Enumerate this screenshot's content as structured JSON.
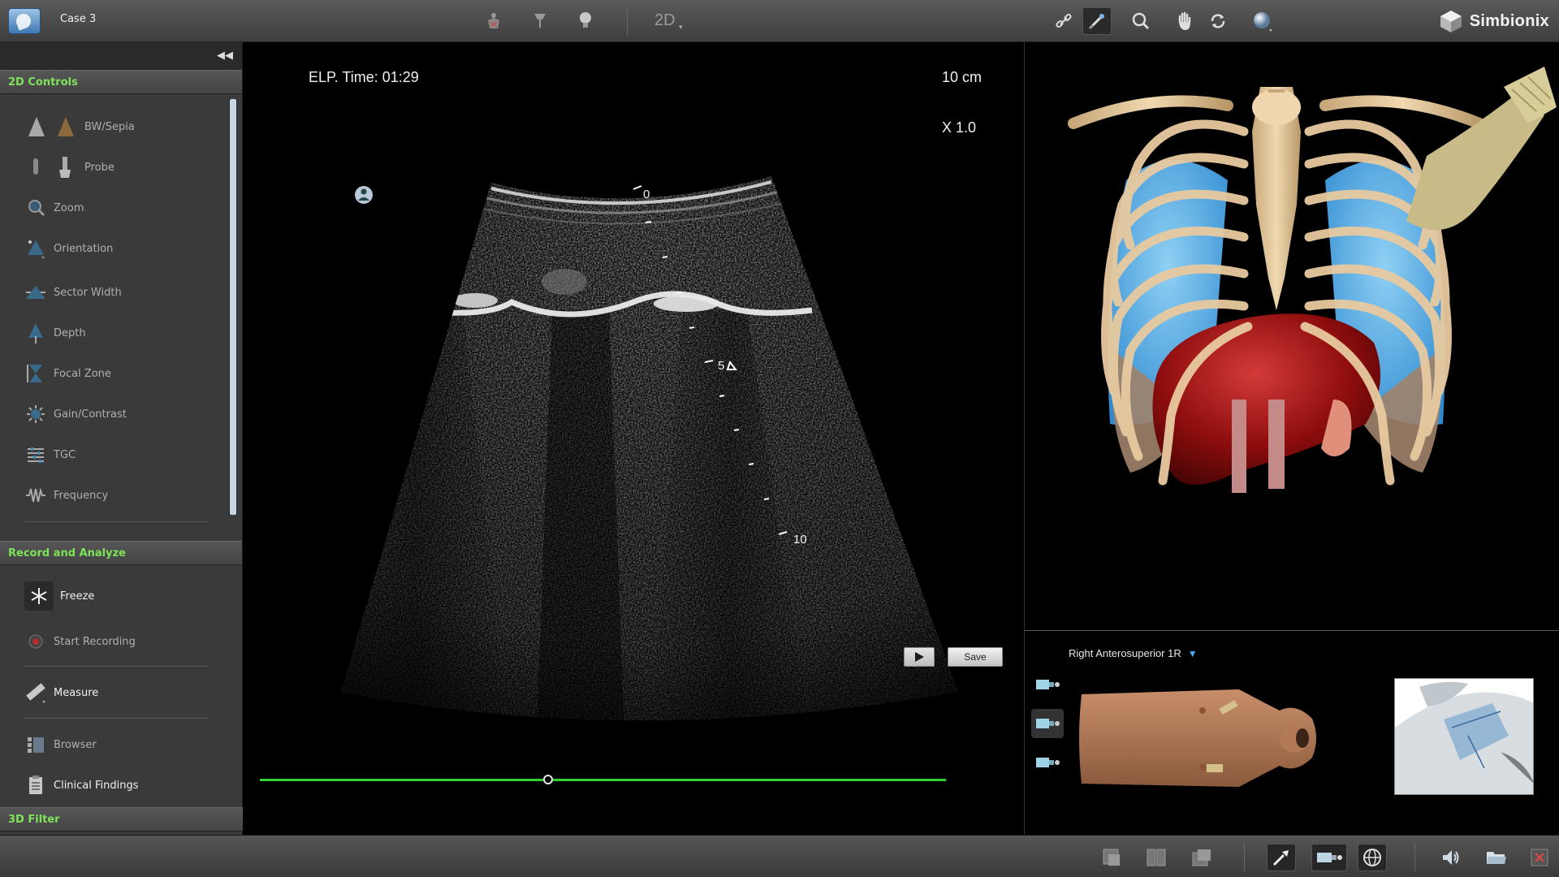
{
  "window": {
    "case_title": "Case 3",
    "brand": "Simbionix"
  },
  "toolbar": {
    "mode_label": "2D",
    "left_icons": [
      "patient-anatomy-icon",
      "pin-icon",
      "lightbulb-icon"
    ],
    "right_icons": [
      "link-icon",
      "probe-link-icon",
      "magnify-icon",
      "hand-pan-icon",
      "rotate-icon",
      "sphere-icon"
    ]
  },
  "sidebar": {
    "collapse_icon": "double-chevron-left-icon",
    "controls_header": "2D Controls",
    "controls": [
      {
        "label": "BW/Sepia",
        "icon": "bw-sepia-icon"
      },
      {
        "label": "Probe",
        "icon": "probe-icon"
      },
      {
        "label": "Zoom",
        "icon": "zoom-icon"
      },
      {
        "label": "Orientation",
        "icon": "orientation-icon"
      },
      {
        "label": "Sector Width",
        "icon": "sector-width-icon"
      },
      {
        "label": "Depth",
        "icon": "depth-icon"
      },
      {
        "label": "Focal Zone",
        "icon": "focal-zone-icon"
      },
      {
        "label": "Gain/Contrast",
        "icon": "gain-contrast-icon"
      },
      {
        "label": "TGC",
        "icon": "tgc-icon"
      },
      {
        "label": "Frequency",
        "icon": "frequency-icon"
      }
    ],
    "record_header": "Record and Analyze",
    "record_items": [
      {
        "label": "Freeze",
        "icon": "snowflake-icon"
      },
      {
        "label": "Start Recording",
        "icon": "record-icon"
      },
      {
        "label": "Measure",
        "icon": "ruler-icon"
      },
      {
        "label": "Browser",
        "icon": "browser-icon"
      },
      {
        "label": "Clinical Findings",
        "icon": "clipboard-icon"
      }
    ],
    "filter_header": "3D Filter"
  },
  "ultrasound": {
    "elapsed_time": "ELP. Time: 01:29",
    "depth": "10 cm",
    "zoom": "X 1.0",
    "depth_scale": [
      "0",
      "5",
      "10"
    ],
    "save_label": "Save",
    "scrub_position": 0.42
  },
  "probe_view": {
    "position_label": "Right Anterosuperior 1R",
    "dropdown_icon": "triangle-down-icon"
  },
  "bottom_toolbar": {
    "icons": [
      "single-view-icon",
      "split-view-icon",
      "overlap-view-icon",
      "probe-tool-icon",
      "probe-position-icon",
      "globe-icon",
      "speaker-icon",
      "folder-icon",
      "close-icon"
    ]
  },
  "colors": {
    "accent_green": "#7fe35a",
    "scrubber": "#2fd22f",
    "lung_blue": "#4aa8e8",
    "bone": "#e8caa0",
    "liver": "#a01010"
  }
}
